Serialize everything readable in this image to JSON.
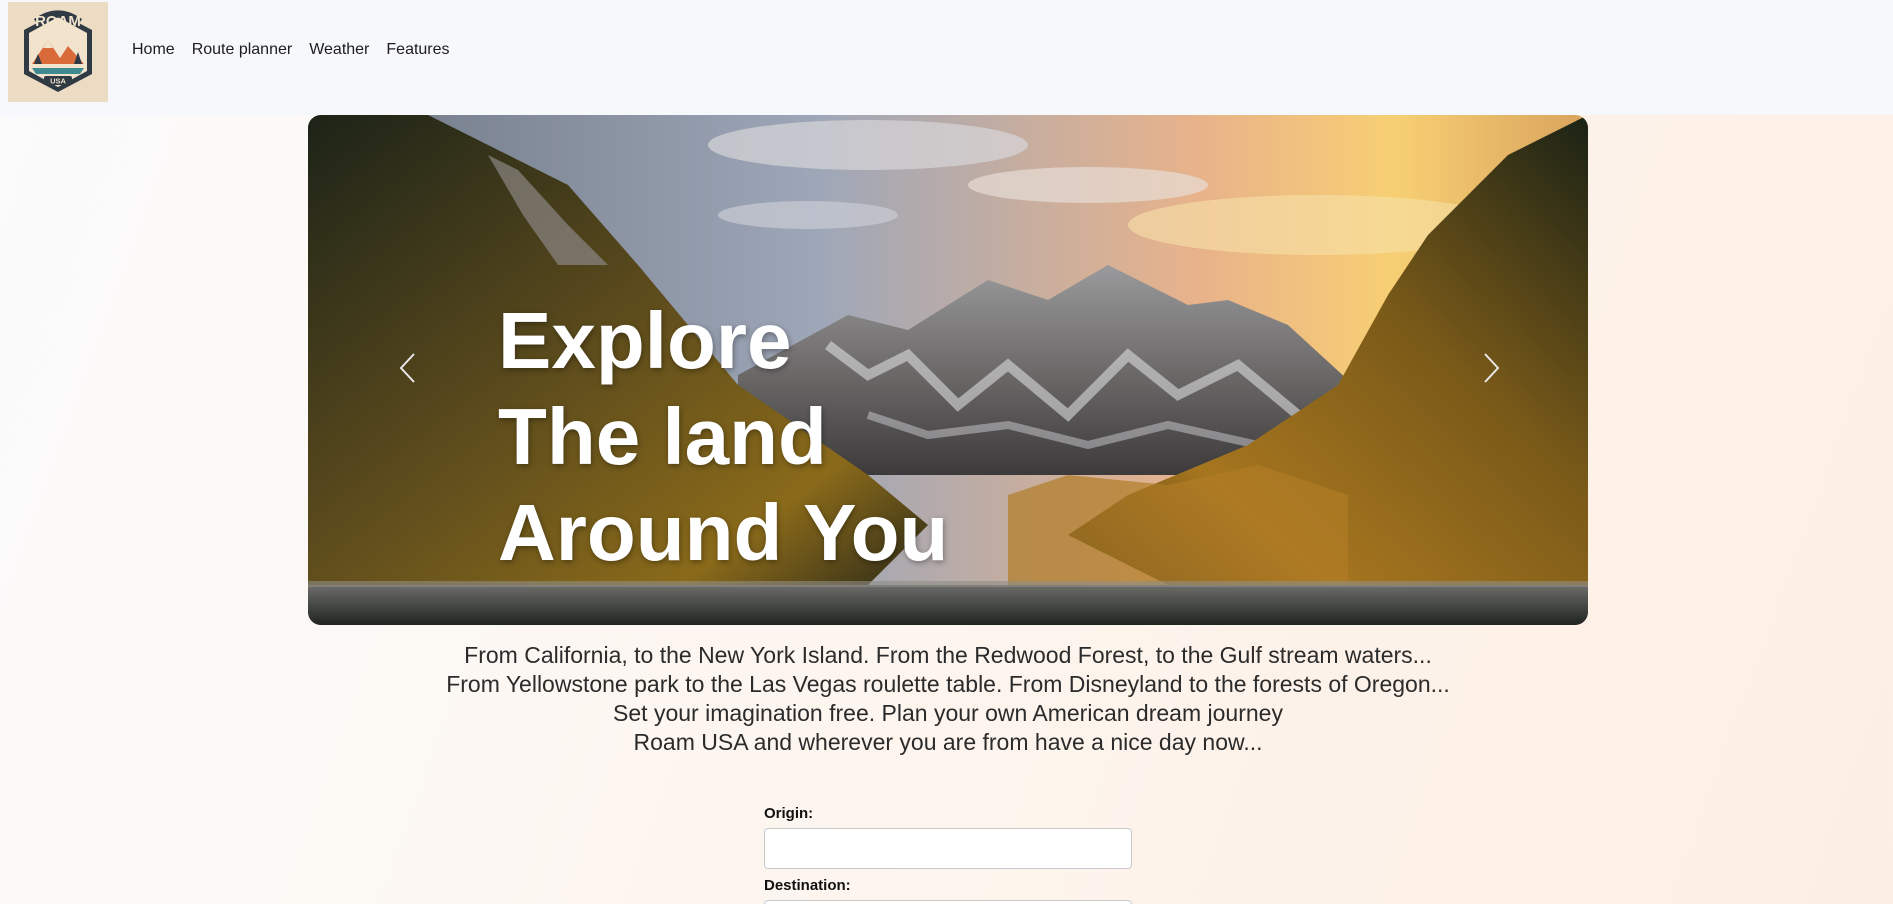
{
  "navbar": {
    "logo": {
      "text": "ROAM",
      "subtext": "USA",
      "icon": "roam-usa-logo"
    },
    "links": [
      {
        "label": "Home"
      },
      {
        "label": "Route planner"
      },
      {
        "label": "Weather"
      },
      {
        "label": "Features"
      }
    ]
  },
  "hero": {
    "title_lines": [
      "Explore",
      "The land",
      "Around You"
    ],
    "prev_icon": "chevron-left-icon",
    "next_icon": "chevron-right-icon"
  },
  "intro": {
    "lines": [
      "From California, to the New York Island. From the Redwood Forest, to the Gulf stream waters...",
      "From Yellowstone park to the Las Vegas roulette table. From Disneyland to the forests of Oregon...",
      "Set your imagination free. Plan your own American dream journey",
      "Roam USA and wherever you are from have a nice day now..."
    ]
  },
  "form": {
    "origin_label": "Origin:",
    "origin_value": "",
    "destination_label": "Destination:",
    "destination_value": ""
  },
  "colors": {
    "navbar_bg": "#f7f8fb",
    "logo_bg": "#ecdcc4",
    "page_bg_warm": "#fdeee3"
  }
}
